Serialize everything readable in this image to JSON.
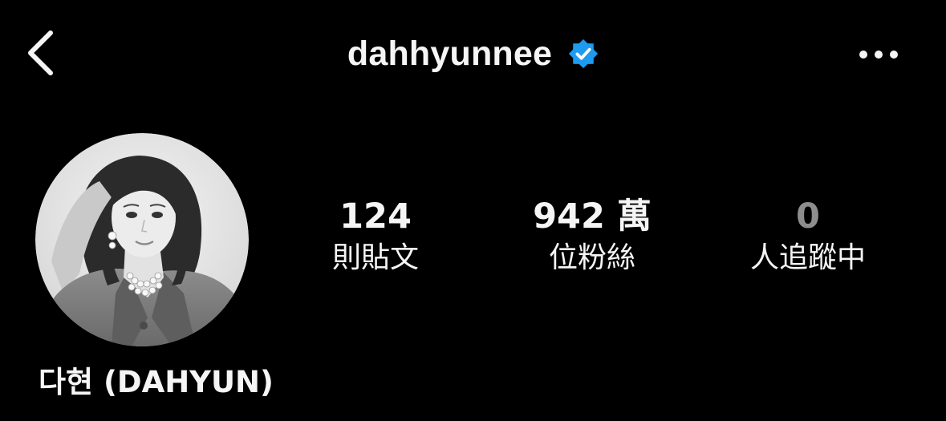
{
  "header": {
    "username": "dahhyunnee",
    "back_icon": "chevron-left-icon",
    "verified_icon": "verified-badge-icon",
    "more_icon": "more-horizontal-icon"
  },
  "profile": {
    "display_name": "다현 (DAHYUN)",
    "avatar_desc_icon": "profile-photo"
  },
  "stats": [
    {
      "value": "124",
      "label": "則貼文"
    },
    {
      "value": "942 萬",
      "label": "位粉絲"
    },
    {
      "value": "0",
      "label": "人追蹤中"
    }
  ],
  "colors": {
    "background": "#000000",
    "text": "#f5f5f5",
    "verified": "#1d9bf0",
    "muted": "#8e8e8e"
  }
}
